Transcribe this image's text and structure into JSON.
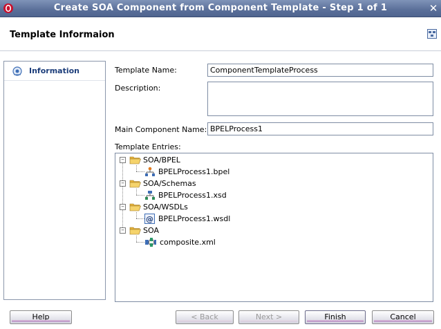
{
  "window": {
    "title": "Create SOA Component from Component Template - Step 1 of 1",
    "close_glyph": "✕"
  },
  "header": {
    "title": "Template Informaion"
  },
  "sidebar": {
    "items": [
      {
        "label": "Information",
        "icon": "info-icon",
        "selected": true
      }
    ]
  },
  "form": {
    "template_name_label": "Template Name:",
    "template_name_value": "ComponentTemplateProcess",
    "description_label": "Description:",
    "description_value": "",
    "main_component_label": "Main Component Name:",
    "main_component_value": "BPELProcess1",
    "template_entries_label": "Template Entries:"
  },
  "tree": {
    "nodes": [
      {
        "label": "SOA/BPEL",
        "type": "folder",
        "expanded": true,
        "children": [
          {
            "label": "BPELProcess1.bpel",
            "icon": "bpel-process-icon"
          }
        ]
      },
      {
        "label": "SOA/Schemas",
        "type": "folder",
        "expanded": true,
        "children": [
          {
            "label": "BPELProcess1.xsd",
            "icon": "schema-icon"
          }
        ]
      },
      {
        "label": "SOA/WSDLs",
        "type": "folder",
        "expanded": true,
        "children": [
          {
            "label": "BPELProcess1.wsdl",
            "icon": "wsdl-icon"
          }
        ]
      },
      {
        "label": "SOA",
        "type": "folder",
        "expanded": true,
        "children": [
          {
            "label": "composite.xml",
            "icon": "composite-icon"
          }
        ]
      }
    ]
  },
  "buttons": {
    "help": "Help",
    "back": "< Back",
    "next": "Next >",
    "finish": "Finish",
    "cancel": "Cancel"
  },
  "colors": {
    "titlebar": "#5a6f99",
    "accent": "#1c3d7a",
    "folder": "#f2c94c"
  }
}
